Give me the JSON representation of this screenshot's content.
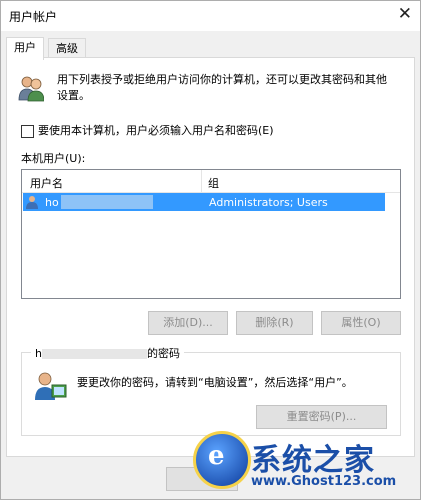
{
  "window": {
    "title": "用户帐户"
  },
  "tabs": [
    {
      "label": "用户"
    },
    {
      "label": "高级"
    }
  ],
  "intro_text": "用下列表授予或拒绝用户访问你的计算机，还可以更改其密码和其他设置。",
  "checkbox": {
    "label": "要使用本计算机，用户必须输入用户名和密码(E)",
    "checked": false
  },
  "user_list": {
    "label": "本机用户(U):",
    "columns": [
      "用户名",
      "组"
    ],
    "rows": [
      {
        "name": "ho",
        "group": "Administrators; Users",
        "selected": true
      }
    ]
  },
  "buttons": {
    "add": "添加(D)...",
    "delete": "删除(R)",
    "properties": "属性(O)"
  },
  "password_group": {
    "title_prefix": "h",
    "title_suffix": "的密码",
    "text": "要更改你的密码，请转到“电脑设置”，然后选择“用户”。",
    "reset_button": "重置密码(P)..."
  },
  "watermark": {
    "title": "系统之家",
    "url": "www.Ghost123.com"
  },
  "colors": {
    "selection": "#3399ff",
    "watermark": "#1b4fa8"
  }
}
